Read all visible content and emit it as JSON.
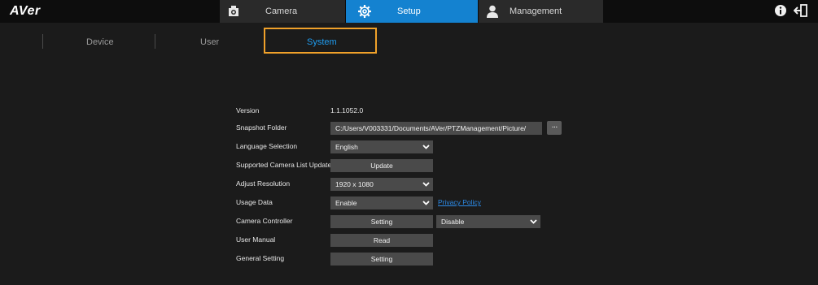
{
  "app": {
    "logo": "AVer"
  },
  "topnav": [
    {
      "label": "Camera",
      "icon": "camera-icon"
    },
    {
      "label": "Setup",
      "icon": "gear-icon"
    },
    {
      "label": "Management",
      "icon": "user-icon"
    }
  ],
  "top_icons": [
    "info-icon",
    "logout-icon"
  ],
  "subtabs": {
    "device": "Device",
    "user": "User",
    "system": "System"
  },
  "form": {
    "version": {
      "label": "Version",
      "value": "1.1.1052.0"
    },
    "snapshot": {
      "label": "Snapshot Folder",
      "value": "C:/Users/V003331/Documents/AVer/PTZManagement/Picture/",
      "button": "···"
    },
    "language": {
      "label": "Language Selection",
      "value": "English"
    },
    "camera_list": {
      "label": "Supported Camera List Update",
      "button": "Update"
    },
    "resolution": {
      "label": "Adjust Resolution",
      "value": "1920 x 1080"
    },
    "usage": {
      "label": "Usage Data",
      "value": "Enable",
      "link": "Privacy Policy"
    },
    "controller": {
      "label": "Camera Controller",
      "button": "Setting",
      "value": "Disable"
    },
    "manual": {
      "label": "User Manual",
      "button": "Read"
    },
    "general": {
      "label": "General Setting",
      "button": "Setting"
    }
  },
  "colors": {
    "accent": "#1482d0",
    "highlight_border": "#f0a12a",
    "link": "#2c8be8"
  }
}
